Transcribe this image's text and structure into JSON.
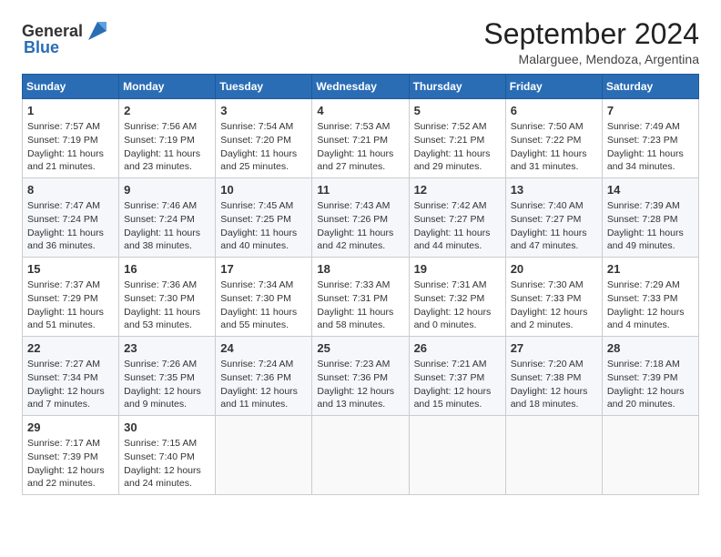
{
  "header": {
    "logo_general": "General",
    "logo_blue": "Blue",
    "month_year": "September 2024",
    "location": "Malarguee, Mendoza, Argentina"
  },
  "weekdays": [
    "Sunday",
    "Monday",
    "Tuesday",
    "Wednesday",
    "Thursday",
    "Friday",
    "Saturday"
  ],
  "weeks": [
    [
      {
        "day": "1",
        "lines": [
          "Sunrise: 7:57 AM",
          "Sunset: 7:19 PM",
          "Daylight: 11 hours",
          "and 21 minutes."
        ]
      },
      {
        "day": "2",
        "lines": [
          "Sunrise: 7:56 AM",
          "Sunset: 7:19 PM",
          "Daylight: 11 hours",
          "and 23 minutes."
        ]
      },
      {
        "day": "3",
        "lines": [
          "Sunrise: 7:54 AM",
          "Sunset: 7:20 PM",
          "Daylight: 11 hours",
          "and 25 minutes."
        ]
      },
      {
        "day": "4",
        "lines": [
          "Sunrise: 7:53 AM",
          "Sunset: 7:21 PM",
          "Daylight: 11 hours",
          "and 27 minutes."
        ]
      },
      {
        "day": "5",
        "lines": [
          "Sunrise: 7:52 AM",
          "Sunset: 7:21 PM",
          "Daylight: 11 hours",
          "and 29 minutes."
        ]
      },
      {
        "day": "6",
        "lines": [
          "Sunrise: 7:50 AM",
          "Sunset: 7:22 PM",
          "Daylight: 11 hours",
          "and 31 minutes."
        ]
      },
      {
        "day": "7",
        "lines": [
          "Sunrise: 7:49 AM",
          "Sunset: 7:23 PM",
          "Daylight: 11 hours",
          "and 34 minutes."
        ]
      }
    ],
    [
      {
        "day": "8",
        "lines": [
          "Sunrise: 7:47 AM",
          "Sunset: 7:24 PM",
          "Daylight: 11 hours",
          "and 36 minutes."
        ]
      },
      {
        "day": "9",
        "lines": [
          "Sunrise: 7:46 AM",
          "Sunset: 7:24 PM",
          "Daylight: 11 hours",
          "and 38 minutes."
        ]
      },
      {
        "day": "10",
        "lines": [
          "Sunrise: 7:45 AM",
          "Sunset: 7:25 PM",
          "Daylight: 11 hours",
          "and 40 minutes."
        ]
      },
      {
        "day": "11",
        "lines": [
          "Sunrise: 7:43 AM",
          "Sunset: 7:26 PM",
          "Daylight: 11 hours",
          "and 42 minutes."
        ]
      },
      {
        "day": "12",
        "lines": [
          "Sunrise: 7:42 AM",
          "Sunset: 7:27 PM",
          "Daylight: 11 hours",
          "and 44 minutes."
        ]
      },
      {
        "day": "13",
        "lines": [
          "Sunrise: 7:40 AM",
          "Sunset: 7:27 PM",
          "Daylight: 11 hours",
          "and 47 minutes."
        ]
      },
      {
        "day": "14",
        "lines": [
          "Sunrise: 7:39 AM",
          "Sunset: 7:28 PM",
          "Daylight: 11 hours",
          "and 49 minutes."
        ]
      }
    ],
    [
      {
        "day": "15",
        "lines": [
          "Sunrise: 7:37 AM",
          "Sunset: 7:29 PM",
          "Daylight: 11 hours",
          "and 51 minutes."
        ]
      },
      {
        "day": "16",
        "lines": [
          "Sunrise: 7:36 AM",
          "Sunset: 7:30 PM",
          "Daylight: 11 hours",
          "and 53 minutes."
        ]
      },
      {
        "day": "17",
        "lines": [
          "Sunrise: 7:34 AM",
          "Sunset: 7:30 PM",
          "Daylight: 11 hours",
          "and 55 minutes."
        ]
      },
      {
        "day": "18",
        "lines": [
          "Sunrise: 7:33 AM",
          "Sunset: 7:31 PM",
          "Daylight: 11 hours",
          "and 58 minutes."
        ]
      },
      {
        "day": "19",
        "lines": [
          "Sunrise: 7:31 AM",
          "Sunset: 7:32 PM",
          "Daylight: 12 hours",
          "and 0 minutes."
        ]
      },
      {
        "day": "20",
        "lines": [
          "Sunrise: 7:30 AM",
          "Sunset: 7:33 PM",
          "Daylight: 12 hours",
          "and 2 minutes."
        ]
      },
      {
        "day": "21",
        "lines": [
          "Sunrise: 7:29 AM",
          "Sunset: 7:33 PM",
          "Daylight: 12 hours",
          "and 4 minutes."
        ]
      }
    ],
    [
      {
        "day": "22",
        "lines": [
          "Sunrise: 7:27 AM",
          "Sunset: 7:34 PM",
          "Daylight: 12 hours",
          "and 7 minutes."
        ]
      },
      {
        "day": "23",
        "lines": [
          "Sunrise: 7:26 AM",
          "Sunset: 7:35 PM",
          "Daylight: 12 hours",
          "and 9 minutes."
        ]
      },
      {
        "day": "24",
        "lines": [
          "Sunrise: 7:24 AM",
          "Sunset: 7:36 PM",
          "Daylight: 12 hours",
          "and 11 minutes."
        ]
      },
      {
        "day": "25",
        "lines": [
          "Sunrise: 7:23 AM",
          "Sunset: 7:36 PM",
          "Daylight: 12 hours",
          "and 13 minutes."
        ]
      },
      {
        "day": "26",
        "lines": [
          "Sunrise: 7:21 AM",
          "Sunset: 7:37 PM",
          "Daylight: 12 hours",
          "and 15 minutes."
        ]
      },
      {
        "day": "27",
        "lines": [
          "Sunrise: 7:20 AM",
          "Sunset: 7:38 PM",
          "Daylight: 12 hours",
          "and 18 minutes."
        ]
      },
      {
        "day": "28",
        "lines": [
          "Sunrise: 7:18 AM",
          "Sunset: 7:39 PM",
          "Daylight: 12 hours",
          "and 20 minutes."
        ]
      }
    ],
    [
      {
        "day": "29",
        "lines": [
          "Sunrise: 7:17 AM",
          "Sunset: 7:39 PM",
          "Daylight: 12 hours",
          "and 22 minutes."
        ]
      },
      {
        "day": "30",
        "lines": [
          "Sunrise: 7:15 AM",
          "Sunset: 7:40 PM",
          "Daylight: 12 hours",
          "and 24 minutes."
        ]
      },
      {
        "day": "",
        "lines": []
      },
      {
        "day": "",
        "lines": []
      },
      {
        "day": "",
        "lines": []
      },
      {
        "day": "",
        "lines": []
      },
      {
        "day": "",
        "lines": []
      }
    ]
  ]
}
